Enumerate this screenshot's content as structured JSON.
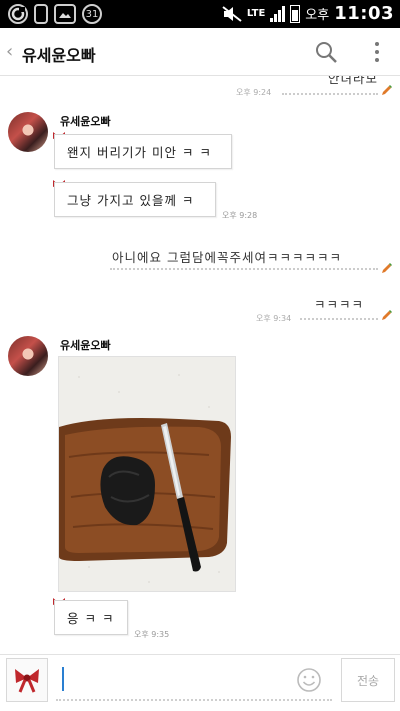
{
  "status_bar": {
    "icons_left": [
      "o-logo-icon",
      "phone-icon",
      "image-icon",
      "badge-31-icon"
    ],
    "badge_number": "31",
    "network": "LTE",
    "ampm": "오후",
    "time": "11:03"
  },
  "header": {
    "back_icon": "chevron-left-icon",
    "title": "유세윤오빠",
    "search_icon": "search-icon",
    "more_icon": "more-vertical-icon"
  },
  "messages": [
    {
      "type": "outgoing",
      "text": "안녀라모",
      "time": "오후 9:24",
      "partial": true
    },
    {
      "type": "incoming",
      "sender": "유세윤오빠",
      "text": "왠지 버리기가 미안 ㅋ ㅋ"
    },
    {
      "type": "incoming",
      "text": "그냥 가지고 있을께 ㅋ",
      "time": "오후 9:28"
    },
    {
      "type": "outgoing",
      "text": "아니에요 그럼담에꼭주세여ㅋㅋㅋㅋㅋㅋ"
    },
    {
      "type": "outgoing",
      "text": "ㅋㅋㅋㅋ",
      "time": "오후 9:34"
    },
    {
      "type": "incoming",
      "sender": "유세윤오빠",
      "attachment": "photo-cutting-board-knife"
    },
    {
      "type": "incoming",
      "text": "응 ㅋ ㅋ",
      "time": "오후 9:35"
    }
  ],
  "input_bar": {
    "gift_icon": "ribbon-bow-icon",
    "placeholder": "",
    "emoji_icon": "smiley-icon",
    "send_label": "전송"
  },
  "colors": {
    "caret": "#2a7fd1",
    "bow": "#c0282d",
    "pencil": "#e07a2a"
  }
}
